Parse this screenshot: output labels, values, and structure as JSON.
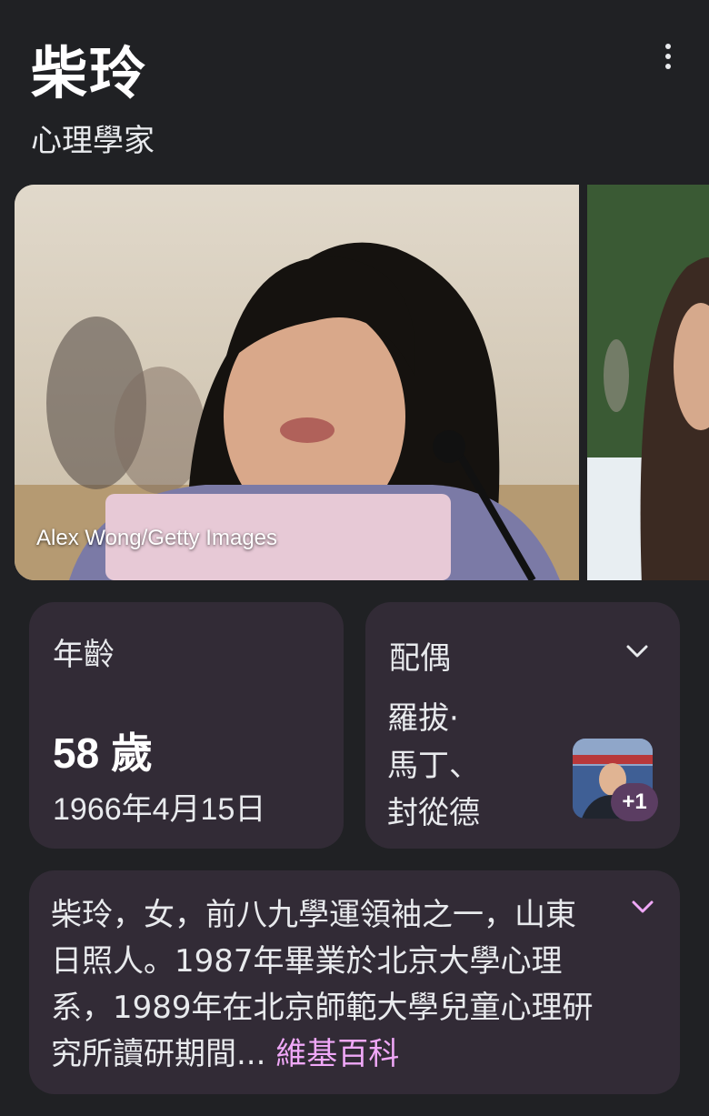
{
  "header": {
    "title": "柴玲",
    "subtitle": "心理學家"
  },
  "images": {
    "credit": "Alex Wong/Getty Images"
  },
  "age_card": {
    "label": "年齡",
    "value": "58 歲",
    "birth_date": "1966年4月15日"
  },
  "spouse_card": {
    "label": "配偶",
    "names_line1": "羅拔·",
    "names_line2": "馬丁、",
    "names_line3": "封從德",
    "more_badge": "+1"
  },
  "description_card": {
    "text": "柴玲，女，前八九學運領袖之一，山東日照人。1987年畢業於北京大學心理系，1989年在北京師範大學兒童心理研究所讀研期間",
    "ellipsis": "... ",
    "source_link": "維基百科"
  },
  "colors": {
    "background": "#202124",
    "card": "#322b36",
    "link": "#f0a8f8",
    "badge": "#5b3d62"
  },
  "icons": {
    "more": "more-vert-icon",
    "expand": "chevron-down-icon"
  }
}
